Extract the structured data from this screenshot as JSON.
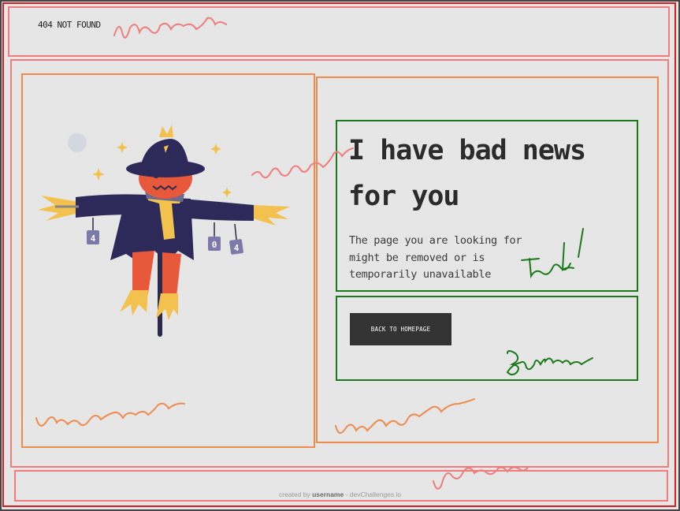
{
  "header": {
    "logo_text": "404 NOT FOUND"
  },
  "main": {
    "headline_line1": "I have bad news",
    "headline_line2": "for you",
    "description": "The page you are looking for might be removed or is temporarily unavailable",
    "button_label": "BACK TO HOMEPAGE",
    "illustration": {
      "icon": "scarecrow-illustration",
      "tags": [
        "4",
        "0",
        "4"
      ]
    }
  },
  "footer": {
    "prefix": "created by",
    "username": "username",
    "suffix": "- devChallenges.io"
  },
  "colors": {
    "background": "#e6e6e6",
    "text": "#2b2b2b",
    "button_bg": "#333333",
    "annotation_red": "#ef7b7b",
    "annotation_orange": "#f08a4b",
    "annotation_green": "#1a7a1a"
  }
}
